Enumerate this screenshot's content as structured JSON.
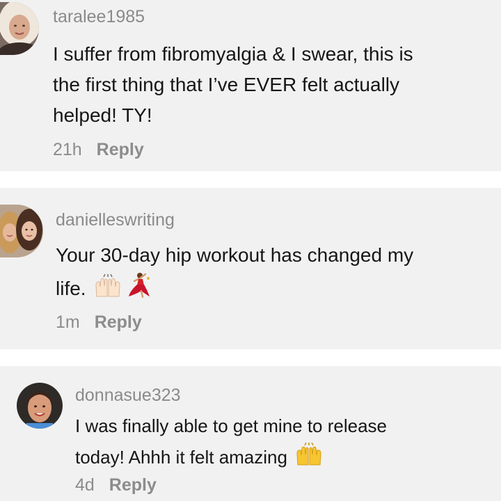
{
  "comments": [
    {
      "username": "taralee1985",
      "text_lines": [
        "I suffer from fibromyalgia & I swear, this is",
        "the first thing that I’ve EVER felt actually",
        "helped! TY!"
      ],
      "age": "21h",
      "reply_label": "Reply",
      "avatar_icon": "user-avatar-blonde"
    },
    {
      "username": "danielleswriting",
      "text_lines": [
        "Your 30-day hip workout has changed my",
        "life."
      ],
      "emojis": [
        "raising-hands-light-icon",
        "dancer-icon"
      ],
      "age": "1m",
      "reply_label": "Reply",
      "avatar_icon": "user-avatar-two-women"
    },
    {
      "username": "donnasue323",
      "text_lines": [
        "I was finally able to get mine to release",
        "today! Ahhh it felt amazing"
      ],
      "emojis": [
        "raising-hands-icon"
      ],
      "age": "4d",
      "reply_label": "Reply",
      "avatar_icon": "user-avatar-brunette"
    }
  ],
  "colors": {
    "card_background": "#f1f1f1",
    "page_background": "#ffffff",
    "username": "#8a8a8a",
    "comment_text": "#161616",
    "meta_text": "#8c8c8c"
  }
}
